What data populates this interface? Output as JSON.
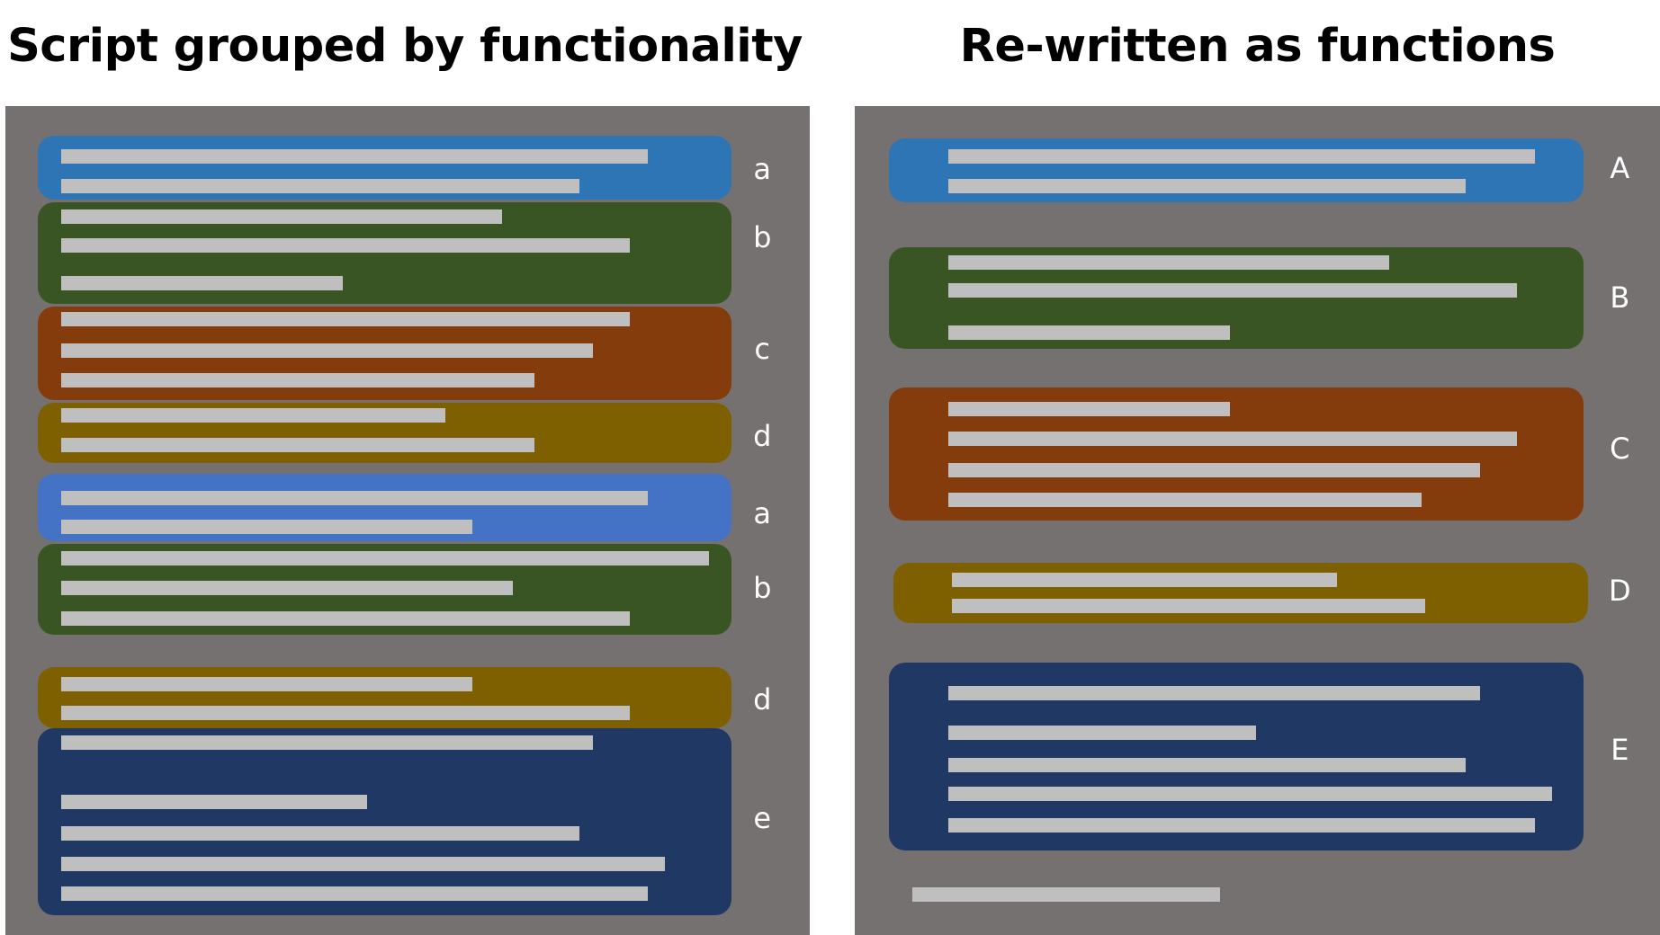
{
  "left": {
    "title": "Script grouped by functionality",
    "blocks": [
      {
        "label": "a",
        "color": "#2E75B6"
      },
      {
        "label": "b",
        "color": "#3A5524"
      },
      {
        "label": "c",
        "color": "#843C0C"
      },
      {
        "label": "d",
        "color": "#7F6000"
      },
      {
        "label": "a",
        "color": "#4472C4"
      },
      {
        "label": "b",
        "color": "#3A5524"
      },
      {
        "label": "d",
        "color": "#7F6000"
      },
      {
        "label": "e",
        "color": "#203864"
      }
    ]
  },
  "right": {
    "title": "Re-written as functions",
    "blocks": [
      {
        "label": "A",
        "color": "#2E75B6"
      },
      {
        "label": "B",
        "color": "#3A5524"
      },
      {
        "label": "C",
        "color": "#843C0C"
      },
      {
        "label": "D",
        "color": "#7F6000"
      },
      {
        "label": "E",
        "color": "#203864"
      }
    ]
  },
  "colors": {
    "panel": "#767171",
    "code_line": "#BFBFBF"
  }
}
